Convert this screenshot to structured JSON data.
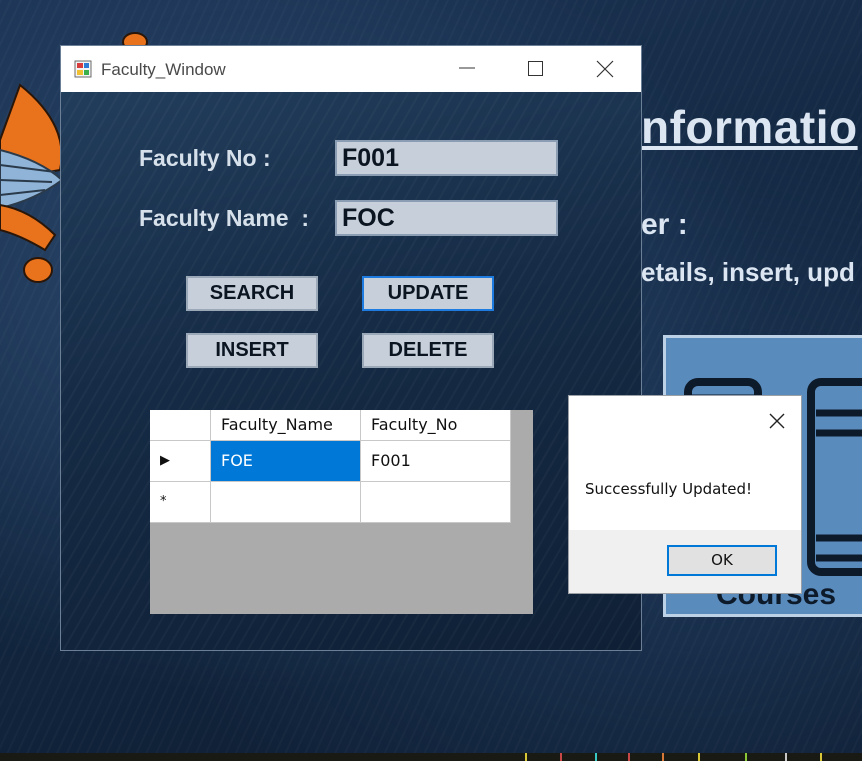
{
  "background": {
    "heading": "nformatio",
    "line1": "er :",
    "line2": "etails, insert, upd",
    "card_label": "Courses"
  },
  "window": {
    "title": "Faculty_Window",
    "faculty_no_label": "Faculty No :",
    "faculty_name_label": "Faculty Name  :",
    "faculty_no_value": "F001",
    "faculty_name_value": "FOC",
    "buttons": {
      "search": "SEARCH",
      "update": "UPDATE",
      "insert": "INSERT",
      "delete": "DELETE"
    },
    "grid": {
      "columns": [
        "Faculty_Name",
        "Faculty_No"
      ],
      "rows": [
        {
          "marker": "▶",
          "faculty_name": "FOE",
          "faculty_no": "F001"
        },
        {
          "marker": "*",
          "faculty_name": "",
          "faculty_no": ""
        }
      ]
    }
  },
  "message_box": {
    "text": "Successfully Updated!",
    "ok_label": "OK"
  },
  "icons": [
    "app-form-icon",
    "minimize-icon",
    "maximize-icon",
    "close-icon",
    "row-pointer-icon",
    "new-row-icon",
    "dialog-close-icon"
  ],
  "colors": {
    "selection": "#0078d7",
    "focus_border": "#1e7be0",
    "window_bg": "#152a44"
  }
}
